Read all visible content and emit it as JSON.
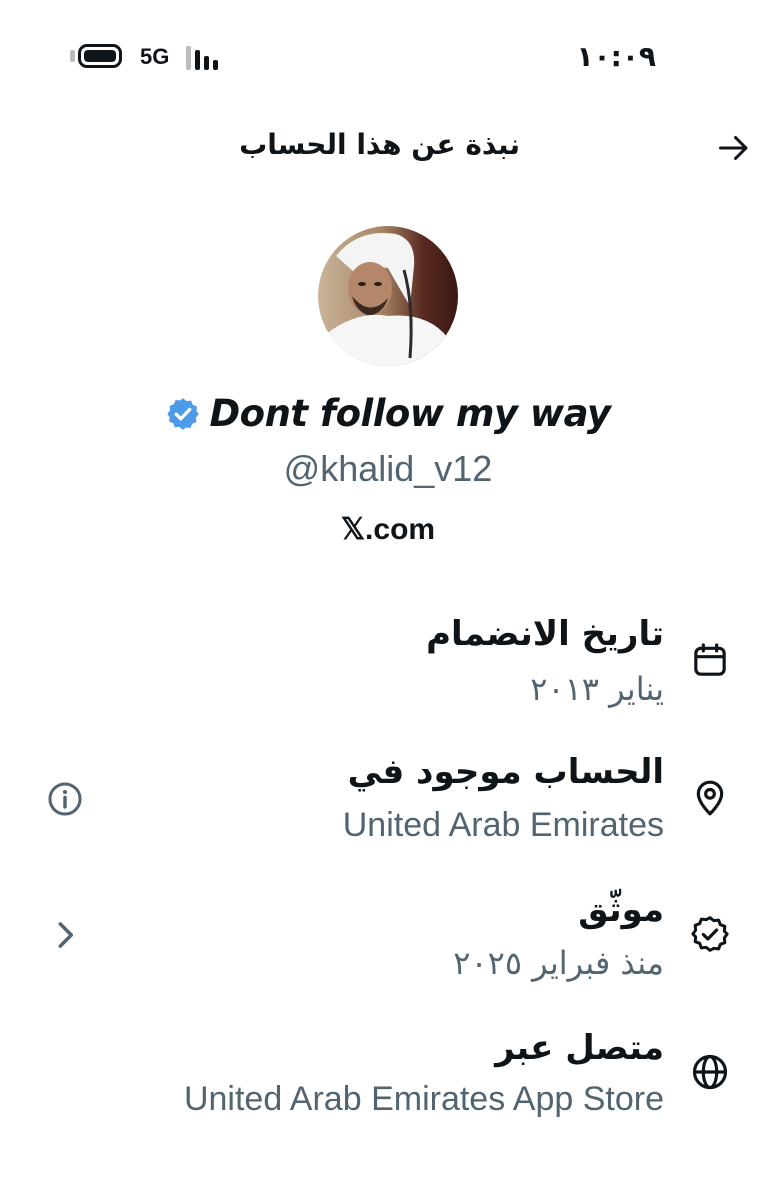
{
  "status_bar": {
    "network": "5G",
    "time": "١٠:٠٩"
  },
  "header": {
    "title": "نبذة عن هذا الحساب",
    "back_icon": "arrow-right-icon"
  },
  "profile": {
    "display_name": "Dont follow my way",
    "verified": true,
    "handle": "@khalid_v12",
    "site": "𝕏.com"
  },
  "rows": [
    {
      "title": "تاريخ الانضمام",
      "value": "يناير ٢٠١٣",
      "icon": "calendar-icon"
    },
    {
      "title": "الحساب موجود في",
      "value": "United Arab Emirates",
      "icon": "location-pin-icon",
      "side_icon": "info-icon"
    },
    {
      "title": "موثّق",
      "value": "منذ فبراير ٢٠٢٥",
      "icon": "verified-badge-icon",
      "side_icon": "chevron-right-icon"
    },
    {
      "title": "متصل عبر",
      "value": "United Arab Emirates App Store",
      "icon": "globe-icon"
    }
  ],
  "colors": {
    "text": "#0f1419",
    "secondary": "#536471",
    "verified_blue": "#1d9bf0"
  }
}
